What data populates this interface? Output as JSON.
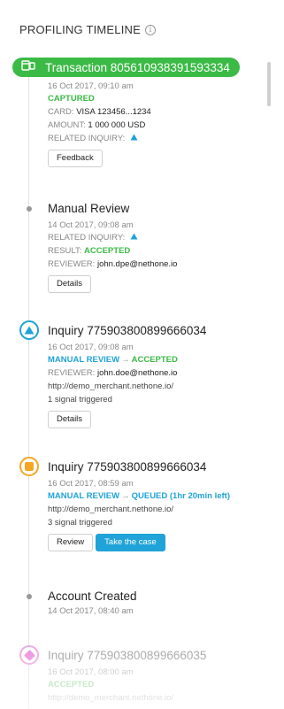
{
  "header": {
    "title": "PROFILING TIMELINE"
  },
  "transaction": {
    "title": "Transaction 805610938391593334",
    "date": "16 Oct 2017, 09:10 am",
    "status": "CAPTURED",
    "card_label": "CARD:",
    "card_value": "VISA 123456...1234",
    "amount_label": "AMOUNT:",
    "amount_value": "1 000 000 USD",
    "related_label": "RELATED INQUIRY:",
    "button": "Feedback"
  },
  "manual_review": {
    "title": "Manual Review",
    "date": "14 Oct 2017, 09:08 am",
    "related_label": "RELATED INQUIRY:",
    "result_label": "RESULT:",
    "result_value": "ACCEPTED",
    "reviewer_label": "REVIEWER:",
    "reviewer_value": "john.dpe@nethone.io",
    "button": "Details"
  },
  "inquiry1": {
    "title": "Inquiry 775903800899666034",
    "date": "16 Oct 2017, 09:08 am",
    "status_from": "MANUAL REVIEW",
    "status_to": "ACCEPTED",
    "reviewer_label": "REVIEWER:",
    "reviewer_value": "john.doe@nethone.io",
    "url": "http://demo_merchant.nethone.io/",
    "signals": "1 signal triggered",
    "button": "Details"
  },
  "inquiry2": {
    "title": "Inquiry 775903800899666034",
    "date": "16 Oct 2017, 08:59 am",
    "status_from": "MANUAL REVIEW",
    "status_to": "QUEUED (1hr 20min left)",
    "url": "http://demo_merchant.nethone.io/",
    "signals": "3 signal triggered",
    "button_review": "Review",
    "button_take": "Take the case"
  },
  "account": {
    "title": "Account Created",
    "date": "14 Oct 2017, 08:40 am"
  },
  "inquiry3": {
    "title": "Inquiry 775903800899666035",
    "date": "16 Oct 2017, 08:00 am",
    "status": "ACCEPTED",
    "url": "http://demo_merchant.nethone.io/"
  },
  "colors": {
    "green": "#3bba45",
    "blue": "#1fa3d8",
    "orange": "#f5a623",
    "pink": "#e45fd6"
  },
  "icons": {
    "transaction": "card-transaction-icon",
    "info": "info-icon",
    "inquiry_accepted": "blue-triangle-icon",
    "inquiry_queued": "orange-square-icon",
    "inquiry_other": "pink-diamond-icon"
  }
}
